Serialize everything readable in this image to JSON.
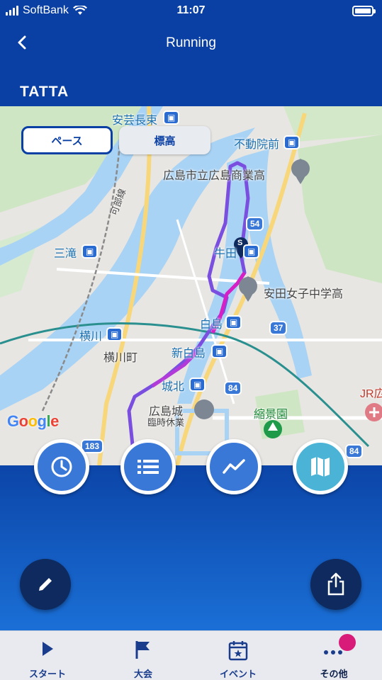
{
  "status": {
    "carrier": "SoftBank",
    "time": "11:07",
    "battery_level": 1.0
  },
  "header": {
    "title": "Running",
    "logo": "TATTA"
  },
  "map": {
    "toggles": [
      {
        "label": "ペース",
        "selected": true
      },
      {
        "label": "標高",
        "selected": false
      }
    ],
    "labels": {
      "aki_nagatsuka": "安芸長束",
      "fudoin_mae": "不動院前",
      "school1": "広島市立広島商業高",
      "kabe_line": "可部線",
      "misasa": "三滝",
      "ushita": "牛田",
      "school2": "安田女子中学高",
      "hakushima": "白島",
      "yokogawa": "横川",
      "yokogawa_cho": "横川町",
      "shin_hakushima": "新白島",
      "johoku": "城北",
      "hiroshima_castle": "広島城",
      "castle_note": "臨時休業",
      "shukkeien": "縮景園",
      "jr": "JR広"
    },
    "route_badges": {
      "r54": "54",
      "r37": "37",
      "r84a": "84",
      "r183": "183",
      "r84b": "84"
    },
    "start_marker": "S",
    "attribution": "Google"
  },
  "actions": [
    {
      "name": "time",
      "icon": "clock-icon"
    },
    {
      "name": "laps",
      "icon": "list-icon"
    },
    {
      "name": "graph",
      "icon": "chart-line-icon"
    },
    {
      "name": "map",
      "icon": "map-icon",
      "active": true
    }
  ],
  "fabs": {
    "edit": "pencil-icon",
    "share": "share-icon"
  },
  "tabs": [
    {
      "label": "スタート",
      "icon": "play-icon"
    },
    {
      "label": "大会",
      "icon": "flag-icon"
    },
    {
      "label": "イベント",
      "icon": "calendar-icon"
    },
    {
      "label": "その他",
      "icon": "more-icon",
      "active": true,
      "has_notification": true
    }
  ],
  "colors": {
    "brand": "#0a3fa3",
    "route_start": "#7a4fe0",
    "route_hot": "#d61fc4",
    "notification": "#d81b78"
  }
}
